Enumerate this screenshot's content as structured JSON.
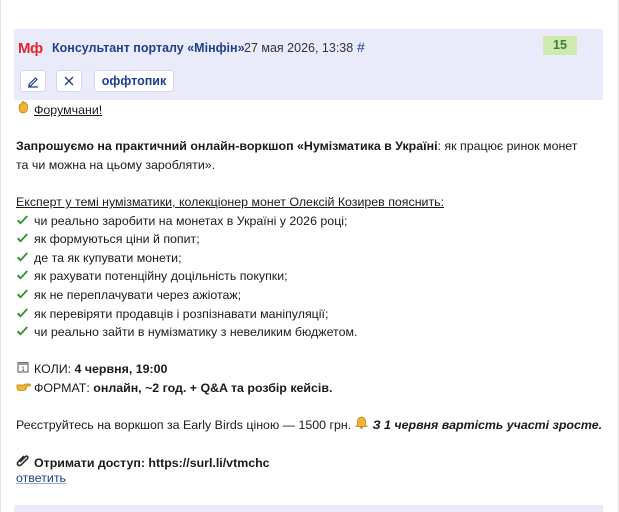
{
  "header": {
    "logo_text": "Мф",
    "author": "Консультант порталу «Мінфін»",
    "date": "27 мая 2026, 13:38",
    "permalink": "#",
    "count": "15",
    "tag_label": "оффтопик",
    "colors": {
      "header_bg": "#e9ebfb",
      "logo": "#e3262c",
      "link": "#1f3f8f",
      "count_bg": "#cfeab1"
    }
  },
  "post": {
    "greeting": "Форумчани!",
    "invite_bold_1": "Запрошуємо на практичний онлайн-воркшоп «Нумізматика в Україні",
    "invite_plain_1": ": як працює ринок монет",
    "invite_line_2": "та чи можна на цьому заробляти».",
    "expert_line": "Експерт у темі нумізматики, колекціонер монет Олексій Козирев пояснить:",
    "checklist": [
      "чи реально заробити на монетах в Україні у 2026 році;",
      "як формуються ціни й попит;",
      "де та як купувати монети;",
      "як рахувати потенційну доцільність покупки;",
      "як не переплачувати через ажіотаж;",
      "як перевіряти продавців і розпізнавати маніпуляції;",
      "чи реально зайти в нумізматику з невеликим бюджетом."
    ],
    "when_label": "КОЛИ: ",
    "when_value": "4 червня, 19:00",
    "format_label": "ФОРМАТ: ",
    "format_value": "онлайн, ~2 год. + Q&A та розбір кейсів.",
    "register_text": "Реєструйтесь на воркшоп за Early Birds ціною — 1500 грн. ",
    "register_emphasis": "З 1 червня вартість участі зросте.",
    "access_text": "Отримати доступ: https://surl.li/vtmchc",
    "icons": [
      "wave-icon",
      "check-icon",
      "calendar-icon",
      "pointing-hand-icon",
      "bell-icon",
      "paperclip-icon"
    ]
  },
  "actions": {
    "reply": "ответить"
  }
}
